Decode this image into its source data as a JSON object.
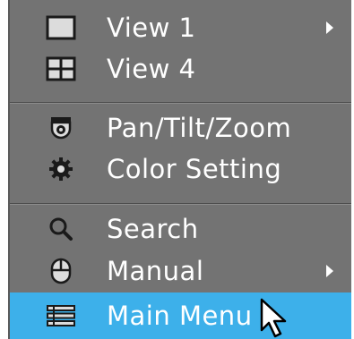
{
  "menu": {
    "items": [
      {
        "label": "View 1",
        "icon": "single-view-icon",
        "has_submenu": true
      },
      {
        "label": "View 4",
        "icon": "quad-view-icon",
        "has_submenu": false
      },
      {
        "label": "Pan/Tilt/Zoom",
        "icon": "camera-dome-icon",
        "has_submenu": false
      },
      {
        "label": "Color Setting",
        "icon": "gear-icon",
        "has_submenu": false
      },
      {
        "label": "Search",
        "icon": "search-icon",
        "has_submenu": false
      },
      {
        "label": "Manual",
        "icon": "mouse-icon",
        "has_submenu": true
      },
      {
        "label": "Main Menu",
        "icon": "list-menu-icon",
        "has_submenu": false,
        "selected": true
      }
    ]
  },
  "colors": {
    "menu_background": "#737373",
    "selected_background": "#3db0ea",
    "text": "#ffffff"
  }
}
